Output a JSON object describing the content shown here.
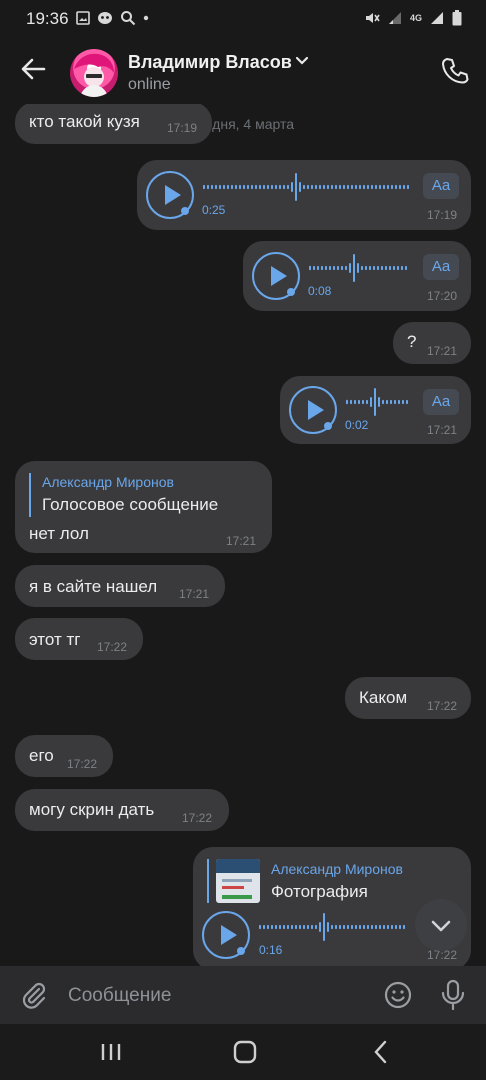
{
  "status_bar": {
    "time": "19:36",
    "network": "4G"
  },
  "header": {
    "contact_name": "Владимир Власов",
    "status": "online",
    "back_icon": "arrow-left-icon",
    "call_icon": "phone-icon"
  },
  "chat": {
    "date_separator": "Сегодня, 4 марта",
    "messages": [
      {
        "type": "text",
        "direction": "in",
        "text": "кто такой кузя",
        "time": "17:19"
      },
      {
        "type": "voice",
        "direction": "out",
        "duration": "0:25",
        "time": "17:19",
        "transcribe_label": "Aa"
      },
      {
        "type": "voice",
        "direction": "out",
        "duration": "0:08",
        "time": "17:20",
        "transcribe_label": "Aa"
      },
      {
        "type": "text",
        "direction": "out",
        "text": "?",
        "time": "17:21"
      },
      {
        "type": "voice",
        "direction": "out",
        "duration": "0:02",
        "time": "17:21",
        "transcribe_label": "Aa"
      },
      {
        "type": "reply",
        "direction": "in",
        "reply_name": "Александр Миронов",
        "reply_text": "Голосовое сообщение",
        "text": "нет лол",
        "time": "17:21"
      },
      {
        "type": "text",
        "direction": "in",
        "text": "я в сайте нашел",
        "time": "17:21"
      },
      {
        "type": "text",
        "direction": "in",
        "text": "этот тг",
        "time": "17:22"
      },
      {
        "type": "text",
        "direction": "out",
        "text": "Каком",
        "time": "17:22"
      },
      {
        "type": "text",
        "direction": "in",
        "text": "его",
        "time": "17:22"
      },
      {
        "type": "text",
        "direction": "in",
        "text": "могу скрин дать",
        "time": "17:22"
      },
      {
        "type": "reply_voice",
        "direction": "out",
        "reply_name": "Александр Миронов",
        "reply_text": "Фотография",
        "duration": "0:16",
        "time": "17:22"
      }
    ]
  },
  "input": {
    "placeholder": "Сообщение",
    "value": ""
  },
  "colors": {
    "background": "#19191a",
    "bubble": "#3a3a3c",
    "accent": "#6aa6ea",
    "meta_text": "#7d8186"
  }
}
